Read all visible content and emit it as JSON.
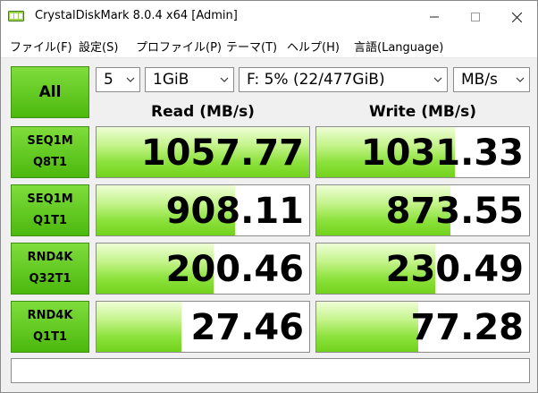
{
  "window": {
    "title": "CrystalDiskMark 8.0.4 x64 [Admin]"
  },
  "menu": [
    "ファイル(F)",
    "設定(S)",
    "プロファイル(P)",
    "テーマ(T)",
    "ヘルプ(H)",
    "言語(Language)"
  ],
  "controls": {
    "all_label": "All",
    "count": "5",
    "size": "1GiB",
    "drive": "F: 5% (22/477GiB)",
    "unit": "MB/s"
  },
  "columns": {
    "read": "Read (MB/s)",
    "write": "Write (MB/s)"
  },
  "tests": [
    {
      "line1": "SEQ1M",
      "line2": "Q8T1",
      "read": "1057.77",
      "write": "1031.33",
      "read_fill": 1.0,
      "write_fill": 0.65
    },
    {
      "line1": "SEQ1M",
      "line2": "Q1T1",
      "read": "908.11",
      "write": "873.55",
      "read_fill": 0.65,
      "write_fill": 0.63
    },
    {
      "line1": "RND4K",
      "line2": "Q32T1",
      "read": "200.46",
      "write": "230.49",
      "read_fill": 0.55,
      "write_fill": 0.56
    },
    {
      "line1": "RND4K",
      "line2": "Q1T1",
      "read": "27.46",
      "write": "77.28",
      "read_fill": 0.4,
      "write_fill": 0.48
    }
  ],
  "status": "",
  "colors": {
    "accent": "#5cc41e",
    "bar": "#8ce23c"
  }
}
